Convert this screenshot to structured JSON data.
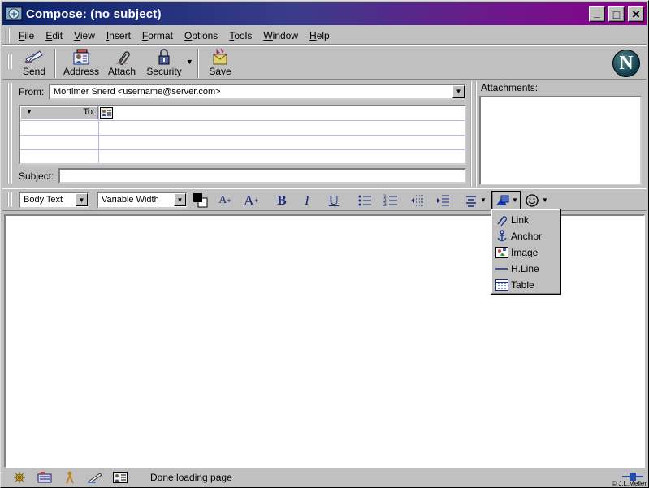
{
  "window": {
    "title": "Compose: (no subject)",
    "minimize_glyph": "_",
    "maximize_glyph": "□",
    "close_glyph": "×"
  },
  "menu": [
    {
      "label": "File",
      "accel": "F",
      "rest": "ile"
    },
    {
      "label": "Edit",
      "accel": "E",
      "rest": "dit"
    },
    {
      "label": "View",
      "accel": "V",
      "rest": "iew"
    },
    {
      "label": "Insert",
      "accel": "I",
      "rest": "nsert"
    },
    {
      "label": "Format",
      "accel": "F",
      "rest": "ormat"
    },
    {
      "label": "Options",
      "accel": "O",
      "rest": "ptions"
    },
    {
      "label": "Tools",
      "accel": "T",
      "rest": "ools"
    },
    {
      "label": "Window",
      "accel": "W",
      "rest": "indow"
    },
    {
      "label": "Help",
      "accel": "H",
      "rest": "elp"
    }
  ],
  "toolbar": {
    "send": "Send",
    "address": "Address",
    "attach": "Attach",
    "security": "Security",
    "save": "Save",
    "logo_letter": "N"
  },
  "header": {
    "from_label": "From:",
    "from_value": "Mortimer Snerd <username@server.com>",
    "to_label": "To:",
    "subject_label": "Subject:",
    "subject_value": "",
    "attachments_label": "Attachments:"
  },
  "format": {
    "paragraph_style": "Body Text",
    "font": "Variable Width",
    "bold": "B",
    "italic": "I",
    "underline": "U"
  },
  "insert_menu": [
    {
      "label": "Link",
      "icon": "link-icon"
    },
    {
      "label": "Anchor",
      "icon": "anchor-icon"
    },
    {
      "label": "Image",
      "icon": "image-icon"
    },
    {
      "label": "H.Line",
      "icon": "hline-icon"
    },
    {
      "label": "Table",
      "icon": "table-icon"
    }
  ],
  "status": {
    "text": "Done loading page",
    "credit": "© J.L.Meller"
  }
}
